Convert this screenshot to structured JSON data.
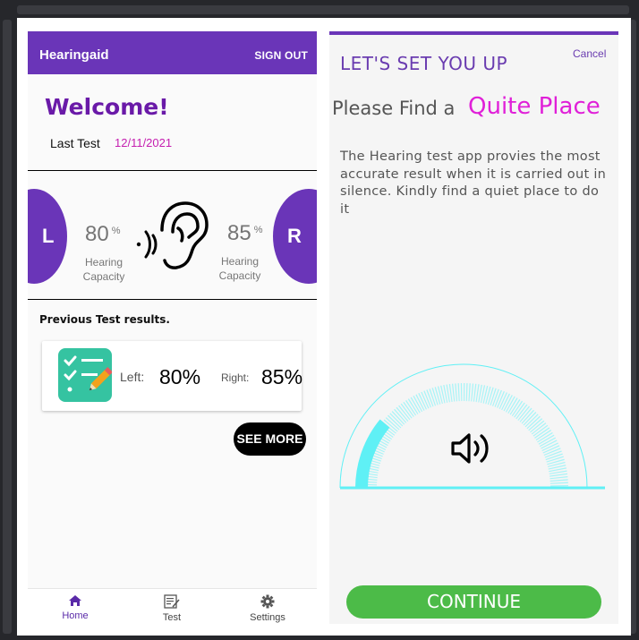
{
  "home_screen": {
    "app_title": "Hearingaid",
    "sign_out_label": "SIGN OUT",
    "welcome": "Welcome!",
    "last_test_label": "Last Test",
    "last_test_date": "12/11/2021",
    "left_ear": {
      "letter": "L",
      "value": "80",
      "unit": "%",
      "caption_line1": "Hearing",
      "caption_line2": "Capacity"
    },
    "right_ear": {
      "letter": "R",
      "value": "85",
      "unit": "%",
      "caption_line1": "Hearing",
      "caption_line2": "Capacity"
    },
    "previous_results_title": "Previous Test results.",
    "result_card": {
      "left_label": "Left:",
      "left_value": "80%",
      "right_label": "Right:",
      "right_value": "85%"
    },
    "see_more_label": "SEE MORE",
    "bottom_nav": [
      {
        "label": "Home",
        "icon": "home-icon",
        "active": true
      },
      {
        "label": "Test",
        "icon": "test-icon",
        "active": false
      },
      {
        "label": "Settings",
        "icon": "gear-icon",
        "active": false
      }
    ],
    "colors": {
      "primary": "#6a35b8",
      "accent_date": "#c51fb0",
      "card_icon_bg": "#35c3a1"
    }
  },
  "setup_screen": {
    "title": "LET'S SET YOU UP",
    "cancel_label": "Cancel",
    "prompt_prefix": "Please Find a",
    "prompt_highlight": "Quite Place",
    "description": "The Hearing test app provies the most accurate result when it is carried out in silence. Kindly find a quiet place to do it",
    "gauge_icon": "speaker-icon",
    "continue_label": "CONTINUE",
    "colors": {
      "title": "#6a3cb0",
      "highlight": "#e020d8",
      "gauge": "#5ff0f5",
      "continue_bg": "#4cbb48"
    }
  }
}
